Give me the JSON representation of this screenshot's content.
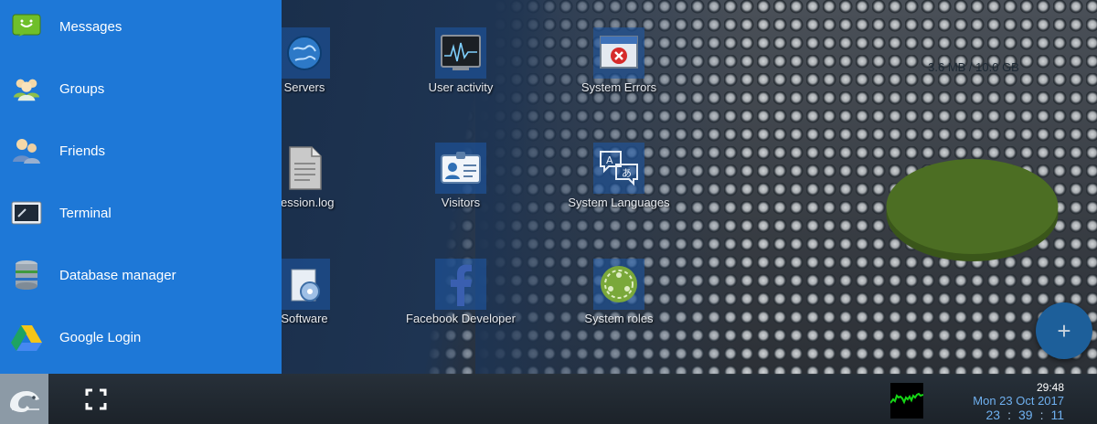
{
  "menu": {
    "items": [
      {
        "label": "Messages",
        "icon": "messages-icon"
      },
      {
        "label": "Groups",
        "icon": "groups-icon"
      },
      {
        "label": "Friends",
        "icon": "friends-icon"
      },
      {
        "label": "Terminal",
        "icon": "terminal-icon"
      },
      {
        "label": "Database manager",
        "icon": "database-icon"
      },
      {
        "label": "Google Login",
        "icon": "google-drive-icon"
      }
    ],
    "background": "#1e78d7"
  },
  "desktop": {
    "icons": [
      {
        "label": "Servers",
        "icon": "globe-icon"
      },
      {
        "label": "User activity",
        "icon": "activity-monitor-icon"
      },
      {
        "label": "System Errors",
        "icon": "error-window-icon"
      },
      {
        "label": "session.log",
        "icon": "log-file-icon"
      },
      {
        "label": "Visitors",
        "icon": "id-card-icon"
      },
      {
        "label": "System Languages",
        "icon": "languages-icon"
      },
      {
        "label": "Software",
        "icon": "software-box-icon"
      },
      {
        "label": "Facebook Developer",
        "icon": "facebook-icon"
      },
      {
        "label": "System roles",
        "icon": "roles-icon"
      }
    ],
    "disk_usage": "3.6 MB / 10.0 GB",
    "add_button": "+"
  },
  "taskbar": {
    "clock_time": "29:48",
    "clock_date": "Mon 23 Oct 2017",
    "clock_hours": "23",
    "clock_minutes": "39",
    "clock_seconds": "11",
    "separator": ":"
  },
  "colors": {
    "accent": "#1e78d7",
    "oval_green": "#4c6e23",
    "clock_blue": "#6fb0ef"
  }
}
